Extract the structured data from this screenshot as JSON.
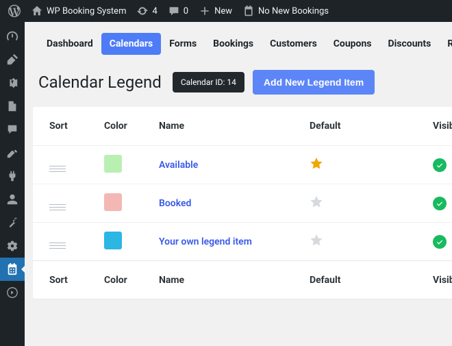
{
  "adminbar": {
    "site_title": "WP Booking System",
    "updates_count": "4",
    "comments_count": "0",
    "new_label": "New",
    "bookings_text": "No New Bookings"
  },
  "tabs": [
    {
      "label": "Dashboard",
      "active": false
    },
    {
      "label": "Calendars",
      "active": true
    },
    {
      "label": "Forms",
      "active": false
    },
    {
      "label": "Bookings",
      "active": false
    },
    {
      "label": "Customers",
      "active": false
    },
    {
      "label": "Coupons",
      "active": false
    },
    {
      "label": "Discounts",
      "active": false
    },
    {
      "label": "Reports",
      "active": false
    }
  ],
  "header": {
    "title": "Calendar Legend",
    "calendar_id_label": "Calendar ID: 14",
    "add_button": "Add New Legend Item"
  },
  "columns": {
    "sort": "Sort",
    "color": "Color",
    "name": "Name",
    "default": "Default",
    "visible": "Visible"
  },
  "rows": [
    {
      "name": "Available",
      "color": "#b9f0b2",
      "default": true,
      "visible": true
    },
    {
      "name": "Booked",
      "color": "#f3b8b3",
      "default": false,
      "visible": true
    },
    {
      "name": "Your own legend item",
      "color": "#2cb6e3",
      "default": false,
      "visible": true
    }
  ]
}
